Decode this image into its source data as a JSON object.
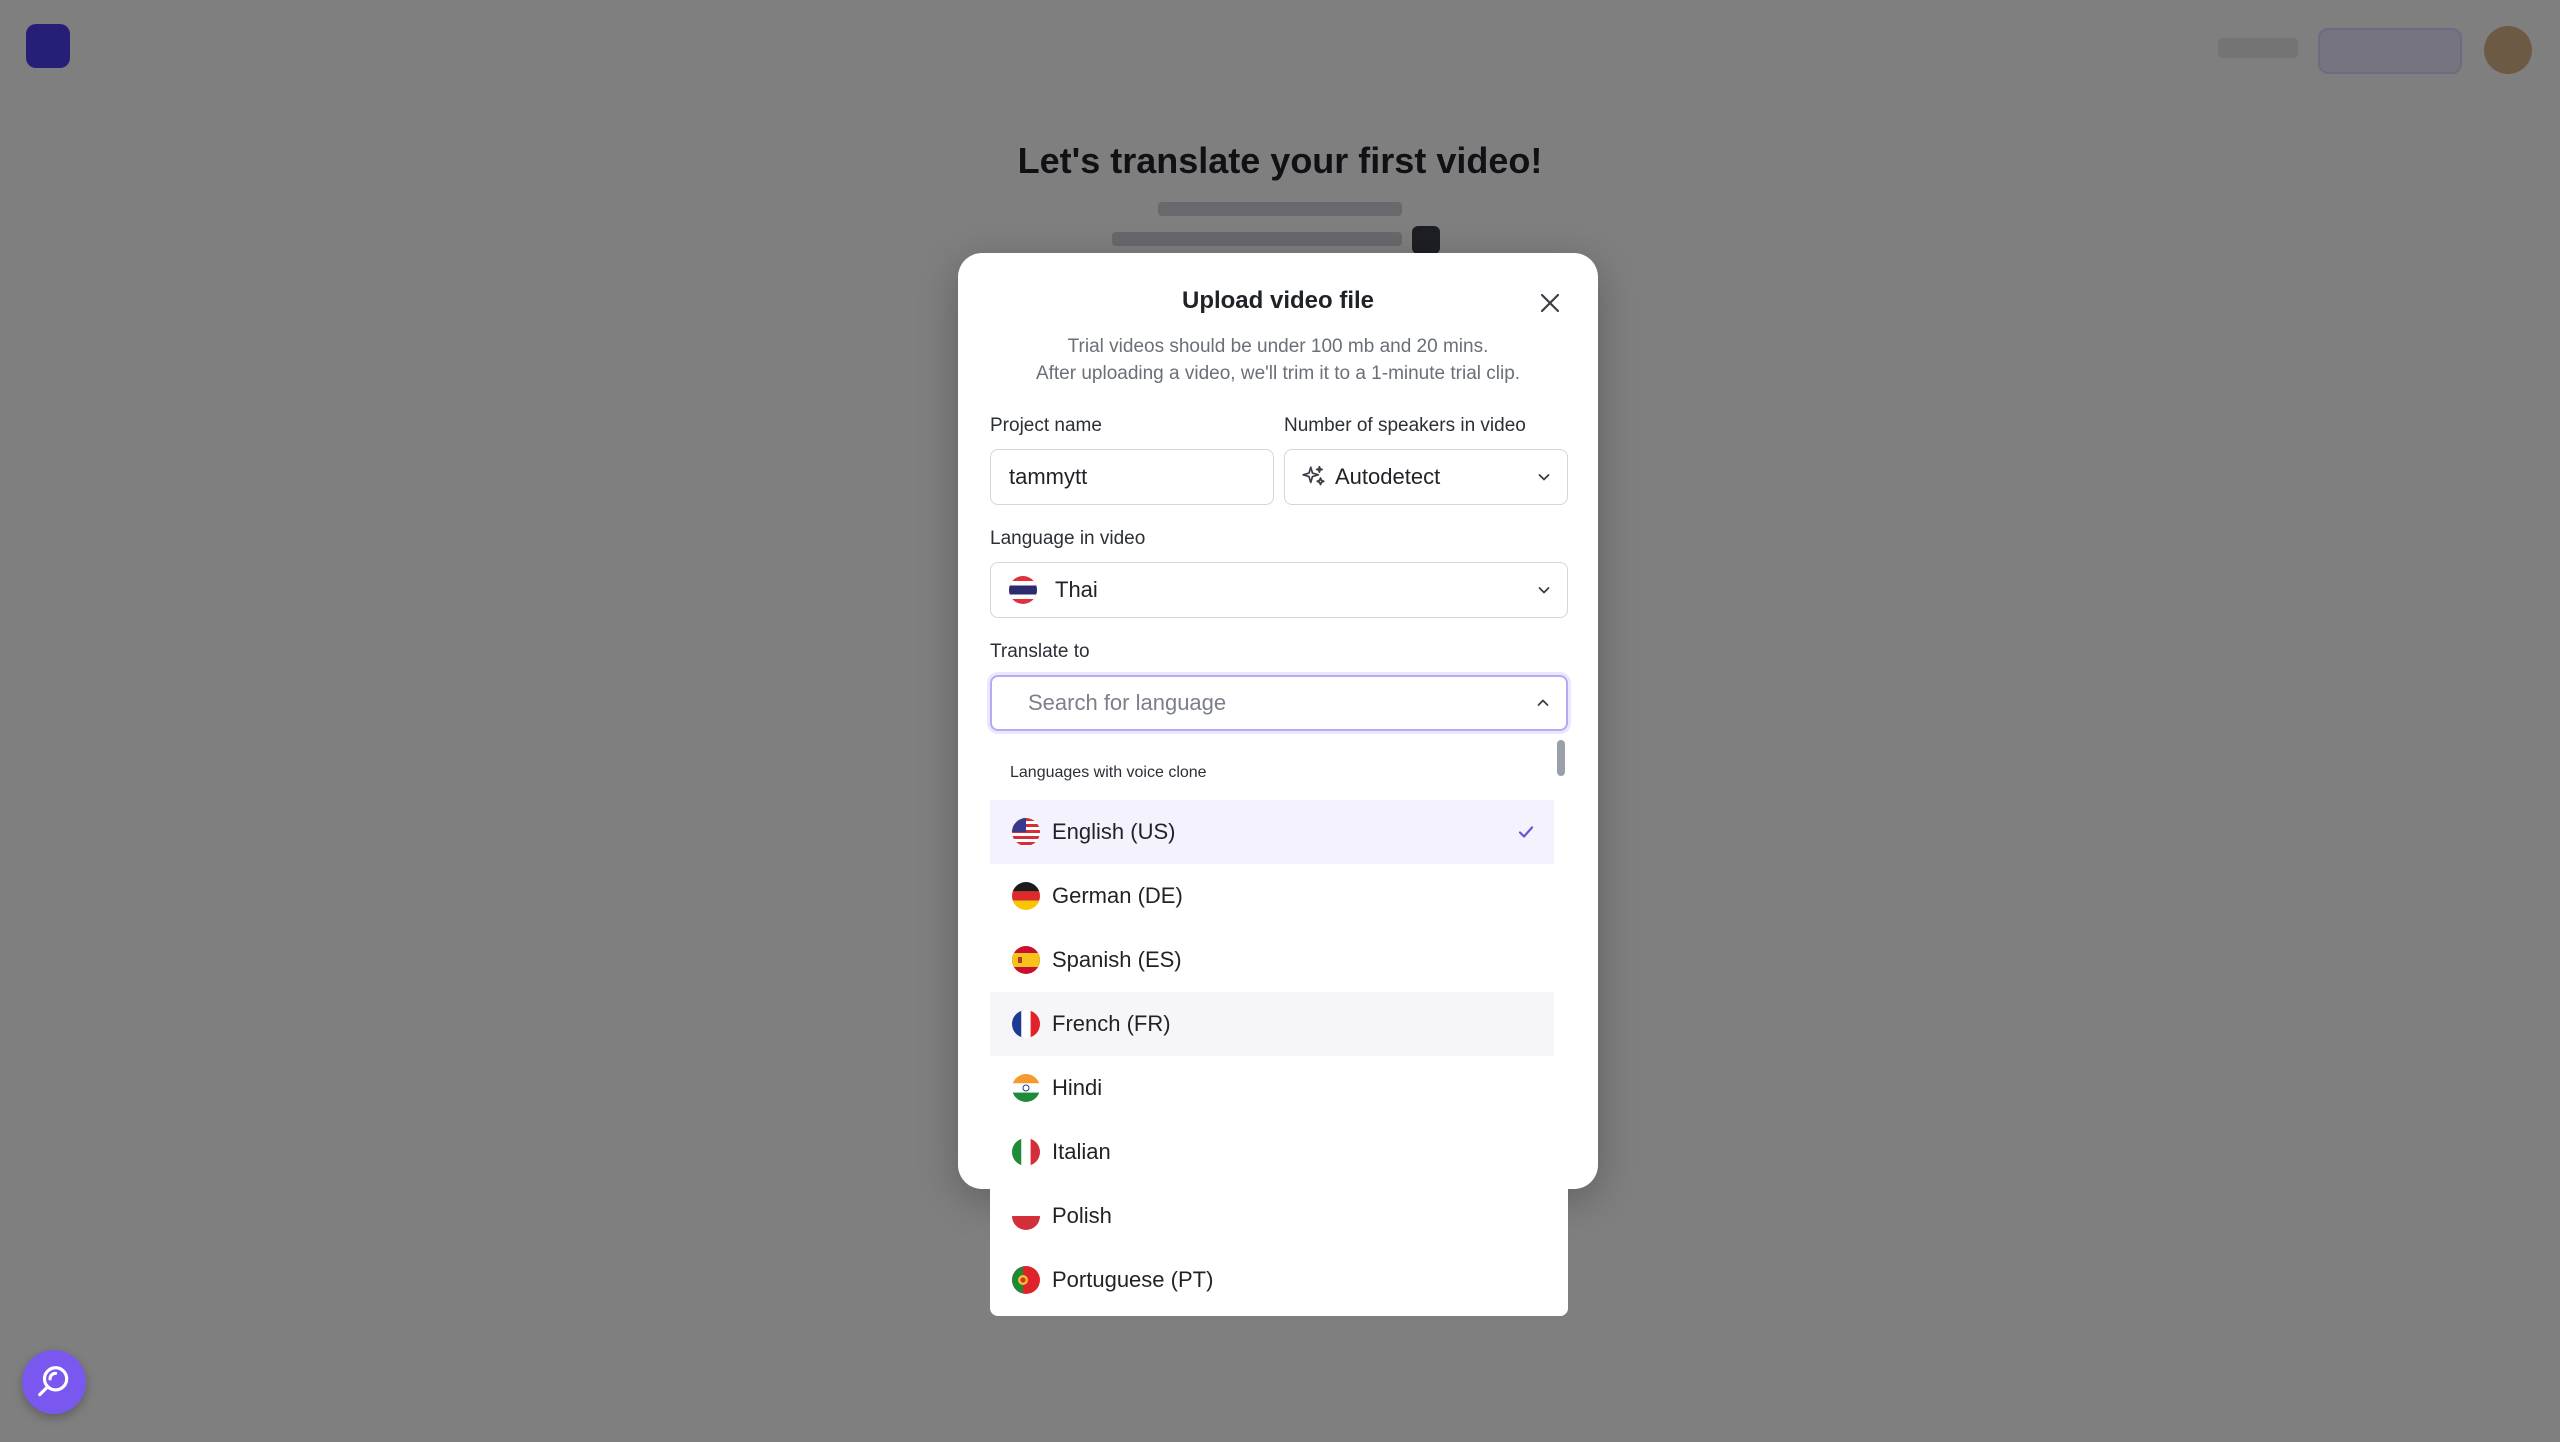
{
  "background": {
    "title": "Let's translate your first video!"
  },
  "modal": {
    "title": "Upload video file",
    "description_line1": "Trial videos should be under 100 mb and 20 mins.",
    "description_line2": "After uploading a video, we'll trim it to a 1-minute trial clip.",
    "project_name": {
      "label": "Project name",
      "value": "tammytt"
    },
    "speakers": {
      "label": "Number of speakers in video",
      "value": "Autodetect",
      "icon": "sparkle-icon"
    },
    "language_in_video": {
      "label": "Language in video",
      "value": "Thai",
      "flag": "thailand"
    },
    "translate_to": {
      "label": "Translate to",
      "placeholder": "Search for language"
    }
  },
  "dropdown": {
    "section_label": "Languages with voice clone",
    "items": [
      {
        "label": "English (US)",
        "flag": "us",
        "selected": true
      },
      {
        "label": "German (DE)",
        "flag": "de"
      },
      {
        "label": "Spanish (ES)",
        "flag": "es"
      },
      {
        "label": "French (FR)",
        "flag": "fr",
        "hovered": true
      },
      {
        "label": "Hindi",
        "flag": "in"
      },
      {
        "label": "Italian",
        "flag": "it"
      },
      {
        "label": "Polish",
        "flag": "pl"
      },
      {
        "label": "Portuguese (PT)",
        "flag": "pt"
      }
    ]
  },
  "colors": {
    "accent": "#7a58f0",
    "focus_border": "#b9a8f3",
    "selected_bg": "#f4f2fd",
    "overlay": "rgba(0,0,0,0.5)"
  }
}
